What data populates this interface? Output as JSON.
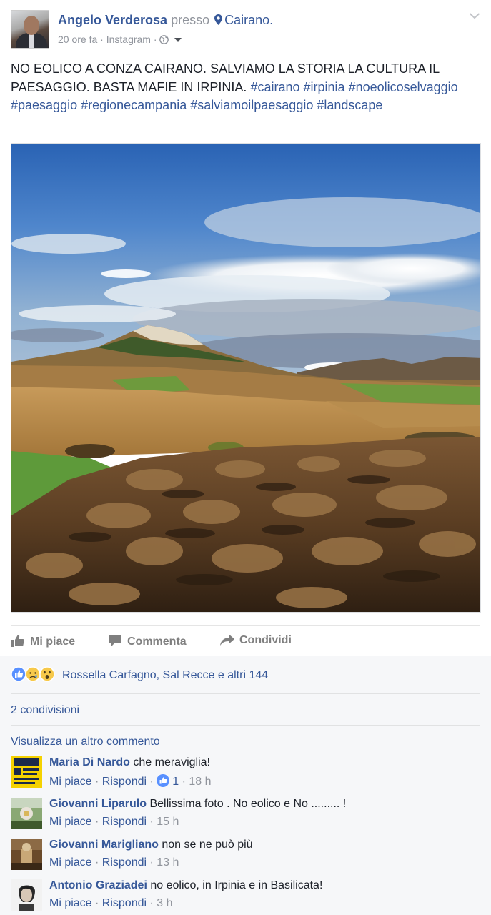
{
  "post": {
    "author": "Angelo Verderosa",
    "presso": "presso",
    "place": "Cairano.",
    "time": "20 ore fa",
    "separator": "·",
    "source": "Instagram",
    "text_main": "NO EOLICO A CONZA CAIRANO. SALVIAMO LA STORIA LA CULTURA IL PAESAGGIO. BASTA MAFIE IN IRPINIA.",
    "hashtags": [
      "#cairano",
      "#irpinia",
      "#noeolicoselvaggio",
      "#paesaggio",
      "#regionecampania",
      "#salviamoilpaesaggio",
      "#landscape"
    ]
  },
  "actions": {
    "like": "Mi piace",
    "comment": "Commenta",
    "share": "Condividi"
  },
  "reactions_text": "Rossella Carfagno, Sal Recce e altri 144",
  "shares_text": "2 condivisioni",
  "more_comments": "Visualizza un altro commento",
  "comments": [
    {
      "name": "Maria Di Nardo",
      "text": "che meraviglia!",
      "like": "Mi piace",
      "reply": "Rispondi",
      "likes": "1",
      "time": "18 h"
    },
    {
      "name": "Giovanni Liparulo",
      "text": "Bellissima foto . No eolico e No ......... !",
      "like": "Mi piace",
      "reply": "Rispondi",
      "time": "15 h"
    },
    {
      "name": "Giovanni Marigliano",
      "text": "non se ne può più",
      "like": "Mi piace",
      "reply": "Rispondi",
      "time": "13 h"
    },
    {
      "name": "Antonio Graziadei",
      "text": "no eolico, in Irpinia e in Basilicata!",
      "like": "Mi piace",
      "reply": "Rispondi",
      "time": "3 h"
    }
  ],
  "icons": [
    "pin-icon",
    "globe-icon",
    "caret-down-icon",
    "chevron-down-icon",
    "like-thumb-icon",
    "comment-bubble-icon",
    "share-arrow-icon",
    "like-reaction-icon",
    "sad-reaction-icon",
    "wow-reaction-icon"
  ],
  "colors": {
    "link": "#365899",
    "meta": "#90949c",
    "like_blue": "#5890ff"
  }
}
